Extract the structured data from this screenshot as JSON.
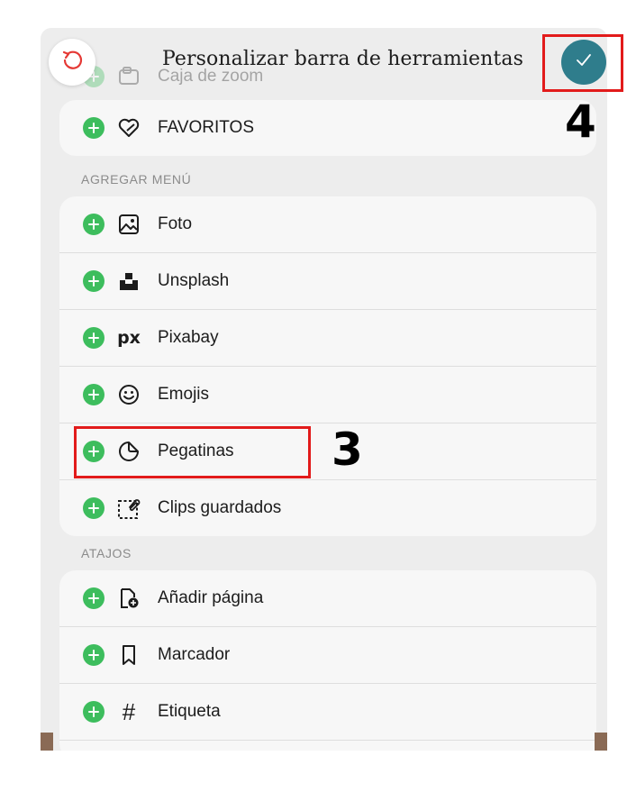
{
  "header": {
    "title": "Personalizar barra de herramientas",
    "faded_item": "Caja de zoom"
  },
  "favorites_card": {
    "label": "FAVORITOS",
    "icon": "heart-outline-icon"
  },
  "sections": {
    "add_menu": {
      "title": "AGREGAR MENÚ",
      "items": [
        {
          "label": "Foto",
          "icon": "photo-icon"
        },
        {
          "label": "Unsplash",
          "icon": "unsplash-icon"
        },
        {
          "label": "Pixabay",
          "icon": "pixabay-icon",
          "glyph": "px"
        },
        {
          "label": "Emojis",
          "icon": "smiley-icon"
        },
        {
          "label": "Pegatinas",
          "icon": "sticker-icon"
        },
        {
          "label": "Clips guardados",
          "icon": "saved-clips-icon"
        }
      ]
    },
    "shortcuts": {
      "title": "ATAJOS",
      "items": [
        {
          "label": "Añadir página",
          "icon": "add-page-icon"
        },
        {
          "label": "Marcador",
          "icon": "bookmark-icon"
        },
        {
          "label": "Etiqueta",
          "icon": "hashtag-icon",
          "glyph": "#"
        }
      ]
    }
  },
  "annotations": {
    "step_3": "3",
    "step_4": "4"
  },
  "colors": {
    "confirm": "#2f7d8c",
    "add": "#3dbd5d",
    "highlight": "#e21b1b",
    "reset_icon": "#e53935"
  }
}
